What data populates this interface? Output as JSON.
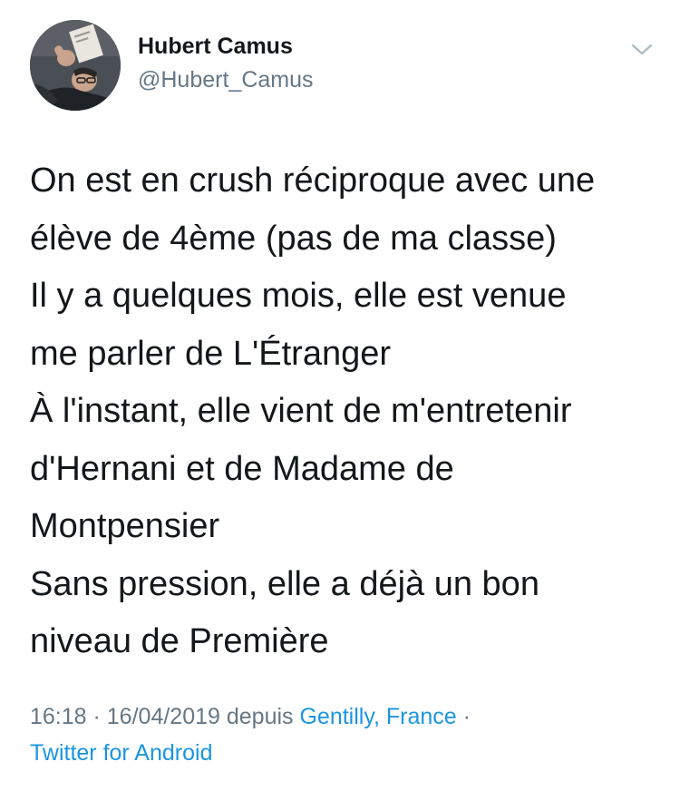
{
  "tweet": {
    "author": {
      "name": "Hubert Camus",
      "handle": "@Hubert_Camus",
      "avatar_icon": "profile-photo"
    },
    "menu_icon": "chevron-down-icon",
    "lines": [
      "On est en crush réciproque avec une",
      "élève de 4ème (pas de ma classe)",
      "Il y a quelques mois, elle est venue",
      "me parler de L'Étranger",
      "À l'instant, elle vient de m'entretenir",
      "d'Hernani et de Madame de",
      "Montpensier",
      "Sans pression, elle a déjà un bon",
      "niveau de Première"
    ],
    "meta": {
      "time": "16:18",
      "sep1": " · ",
      "date": "16/04/2019",
      "depuis": " depuis ",
      "location": "Gentilly, France",
      "sep2": " ·",
      "client": "Twitter for Android"
    }
  },
  "colors": {
    "text": "#14171a",
    "secondary": "#657786",
    "link": "#1b95e0"
  }
}
